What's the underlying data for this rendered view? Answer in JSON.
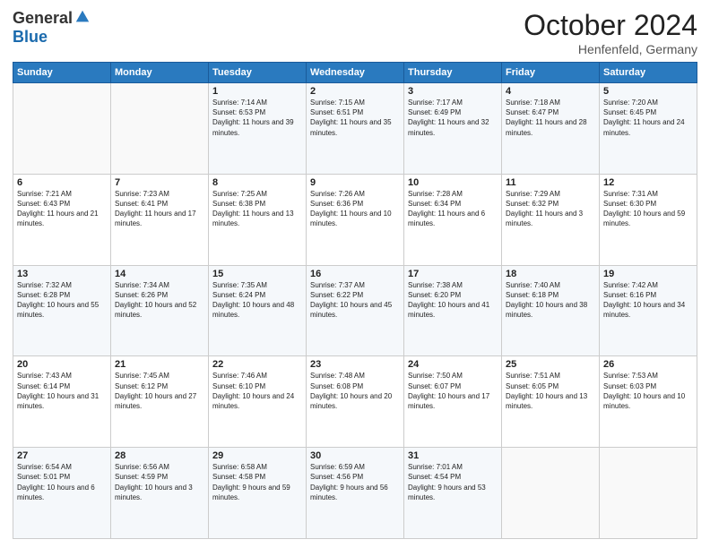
{
  "header": {
    "logo_general": "General",
    "logo_blue": "Blue",
    "month": "October 2024",
    "location": "Henfenfeld, Germany"
  },
  "days_of_week": [
    "Sunday",
    "Monday",
    "Tuesday",
    "Wednesday",
    "Thursday",
    "Friday",
    "Saturday"
  ],
  "weeks": [
    [
      {
        "day": "",
        "info": ""
      },
      {
        "day": "",
        "info": ""
      },
      {
        "day": "1",
        "sunrise": "7:14 AM",
        "sunset": "6:53 PM",
        "daylight": "11 hours and 39 minutes."
      },
      {
        "day": "2",
        "sunrise": "7:15 AM",
        "sunset": "6:51 PM",
        "daylight": "11 hours and 35 minutes."
      },
      {
        "day": "3",
        "sunrise": "7:17 AM",
        "sunset": "6:49 PM",
        "daylight": "11 hours and 32 minutes."
      },
      {
        "day": "4",
        "sunrise": "7:18 AM",
        "sunset": "6:47 PM",
        "daylight": "11 hours and 28 minutes."
      },
      {
        "day": "5",
        "sunrise": "7:20 AM",
        "sunset": "6:45 PM",
        "daylight": "11 hours and 24 minutes."
      }
    ],
    [
      {
        "day": "6",
        "sunrise": "7:21 AM",
        "sunset": "6:43 PM",
        "daylight": "11 hours and 21 minutes."
      },
      {
        "day": "7",
        "sunrise": "7:23 AM",
        "sunset": "6:41 PM",
        "daylight": "11 hours and 17 minutes."
      },
      {
        "day": "8",
        "sunrise": "7:25 AM",
        "sunset": "6:38 PM",
        "daylight": "11 hours and 13 minutes."
      },
      {
        "day": "9",
        "sunrise": "7:26 AM",
        "sunset": "6:36 PM",
        "daylight": "11 hours and 10 minutes."
      },
      {
        "day": "10",
        "sunrise": "7:28 AM",
        "sunset": "6:34 PM",
        "daylight": "11 hours and 6 minutes."
      },
      {
        "day": "11",
        "sunrise": "7:29 AM",
        "sunset": "6:32 PM",
        "daylight": "11 hours and 3 minutes."
      },
      {
        "day": "12",
        "sunrise": "7:31 AM",
        "sunset": "6:30 PM",
        "daylight": "10 hours and 59 minutes."
      }
    ],
    [
      {
        "day": "13",
        "sunrise": "7:32 AM",
        "sunset": "6:28 PM",
        "daylight": "10 hours and 55 minutes."
      },
      {
        "day": "14",
        "sunrise": "7:34 AM",
        "sunset": "6:26 PM",
        "daylight": "10 hours and 52 minutes."
      },
      {
        "day": "15",
        "sunrise": "7:35 AM",
        "sunset": "6:24 PM",
        "daylight": "10 hours and 48 minutes."
      },
      {
        "day": "16",
        "sunrise": "7:37 AM",
        "sunset": "6:22 PM",
        "daylight": "10 hours and 45 minutes."
      },
      {
        "day": "17",
        "sunrise": "7:38 AM",
        "sunset": "6:20 PM",
        "daylight": "10 hours and 41 minutes."
      },
      {
        "day": "18",
        "sunrise": "7:40 AM",
        "sunset": "6:18 PM",
        "daylight": "10 hours and 38 minutes."
      },
      {
        "day": "19",
        "sunrise": "7:42 AM",
        "sunset": "6:16 PM",
        "daylight": "10 hours and 34 minutes."
      }
    ],
    [
      {
        "day": "20",
        "sunrise": "7:43 AM",
        "sunset": "6:14 PM",
        "daylight": "10 hours and 31 minutes."
      },
      {
        "day": "21",
        "sunrise": "7:45 AM",
        "sunset": "6:12 PM",
        "daylight": "10 hours and 27 minutes."
      },
      {
        "day": "22",
        "sunrise": "7:46 AM",
        "sunset": "6:10 PM",
        "daylight": "10 hours and 24 minutes."
      },
      {
        "day": "23",
        "sunrise": "7:48 AM",
        "sunset": "6:08 PM",
        "daylight": "10 hours and 20 minutes."
      },
      {
        "day": "24",
        "sunrise": "7:50 AM",
        "sunset": "6:07 PM",
        "daylight": "10 hours and 17 minutes."
      },
      {
        "day": "25",
        "sunrise": "7:51 AM",
        "sunset": "6:05 PM",
        "daylight": "10 hours and 13 minutes."
      },
      {
        "day": "26",
        "sunrise": "7:53 AM",
        "sunset": "6:03 PM",
        "daylight": "10 hours and 10 minutes."
      }
    ],
    [
      {
        "day": "27",
        "sunrise": "6:54 AM",
        "sunset": "5:01 PM",
        "daylight": "10 hours and 6 minutes."
      },
      {
        "day": "28",
        "sunrise": "6:56 AM",
        "sunset": "4:59 PM",
        "daylight": "10 hours and 3 minutes."
      },
      {
        "day": "29",
        "sunrise": "6:58 AM",
        "sunset": "4:58 PM",
        "daylight": "9 hours and 59 minutes."
      },
      {
        "day": "30",
        "sunrise": "6:59 AM",
        "sunset": "4:56 PM",
        "daylight": "9 hours and 56 minutes."
      },
      {
        "day": "31",
        "sunrise": "7:01 AM",
        "sunset": "4:54 PM",
        "daylight": "9 hours and 53 minutes."
      },
      {
        "day": "",
        "info": ""
      },
      {
        "day": "",
        "info": ""
      }
    ]
  ]
}
